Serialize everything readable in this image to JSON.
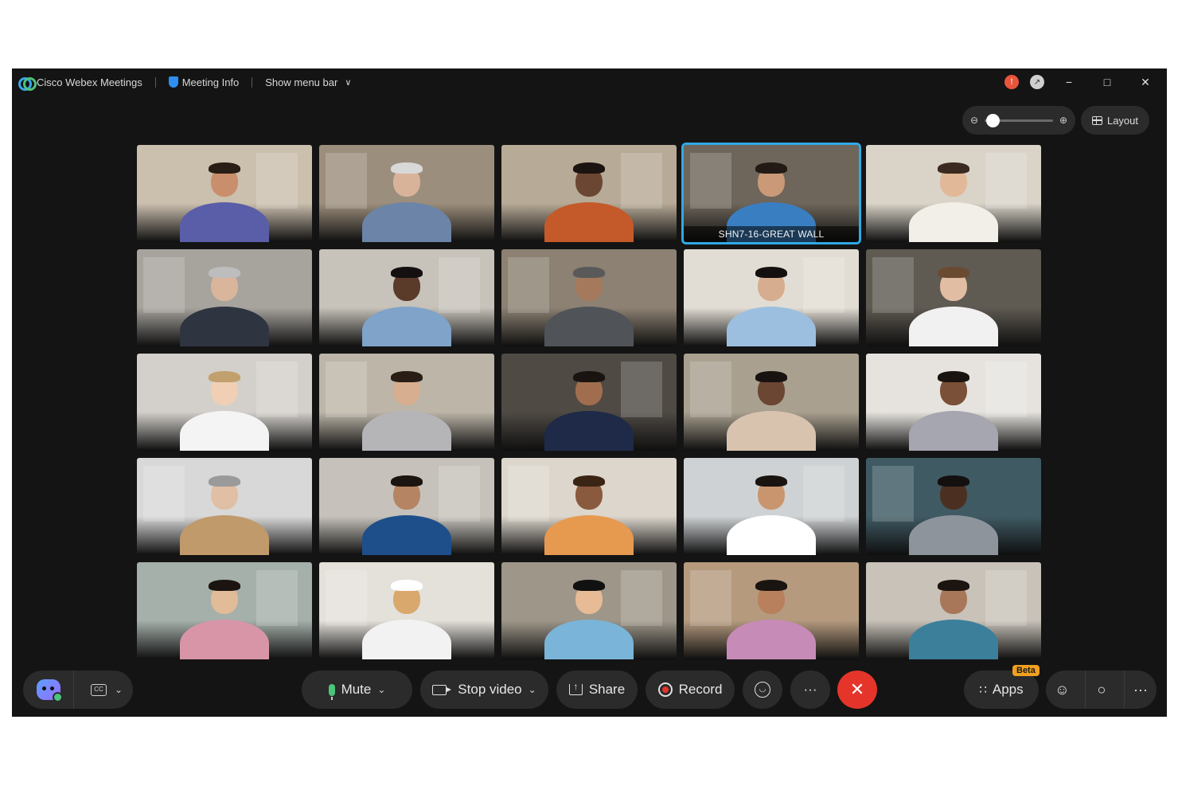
{
  "titlebar": {
    "app_title": "Cisco Webex Meetings",
    "meeting_info": "Meeting Info",
    "show_menu_bar": "Show menu bar",
    "chevron": "∨",
    "minimize": "−",
    "maximize": "□",
    "close": "✕"
  },
  "view": {
    "zoom_level": 0.0,
    "zoom_out_glyph": "⊖",
    "zoom_in_glyph": "⊕",
    "layout_label": "Layout"
  },
  "grid": {
    "tiles": [
      {
        "label": ""
      },
      {
        "label": ""
      },
      {
        "label": ""
      },
      {
        "label": "SHN7-16-GREAT WALL",
        "active": true
      },
      {
        "label": ""
      },
      {
        "label": ""
      },
      {
        "label": ""
      },
      {
        "label": ""
      },
      {
        "label": ""
      },
      {
        "label": ""
      },
      {
        "label": ""
      },
      {
        "label": ""
      },
      {
        "label": ""
      },
      {
        "label": ""
      },
      {
        "label": ""
      },
      {
        "label": ""
      },
      {
        "label": ""
      },
      {
        "label": ""
      },
      {
        "label": ""
      },
      {
        "label": ""
      },
      {
        "label": ""
      },
      {
        "label": ""
      },
      {
        "label": ""
      },
      {
        "label": ""
      },
      {
        "label": ""
      }
    ]
  },
  "controls": {
    "caret": "⌄",
    "cc_glyph": "CC",
    "mute": "Mute",
    "stop_video": "Stop video",
    "share": "Share",
    "record": "Record",
    "more": "···",
    "leave": "✕",
    "apps": "Apps",
    "beta": "Beta"
  },
  "colors": {
    "background": "#141414",
    "accent": "#2fa9e6",
    "leave": "#e5352b",
    "mic": "#4cc47a",
    "beta": "#f0a020"
  }
}
